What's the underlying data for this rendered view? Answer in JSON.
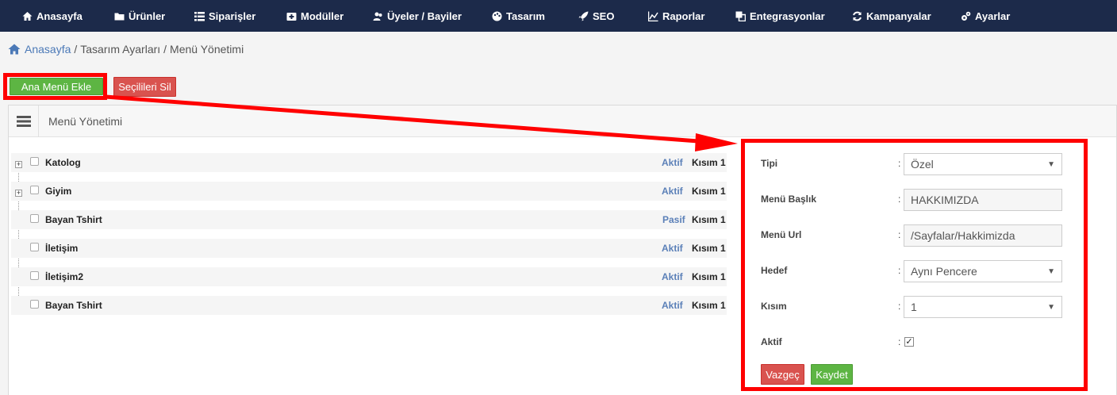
{
  "nav": [
    {
      "label": "Anasayfa",
      "icon": "home-icon"
    },
    {
      "label": "Ürünler",
      "icon": "folder-icon"
    },
    {
      "label": "Siparişler",
      "icon": "list-icon"
    },
    {
      "label": "Modüller",
      "icon": "module-icon"
    },
    {
      "label": "Üyeler / Bayiler",
      "icon": "users-icon"
    },
    {
      "label": "Tasarım",
      "icon": "palette-icon"
    },
    {
      "label": "SEO",
      "icon": "rocket-icon"
    },
    {
      "label": "Raporlar",
      "icon": "chart-icon"
    },
    {
      "label": "Entegrasyonlar",
      "icon": "integration-icon"
    },
    {
      "label": "Kampanyalar",
      "icon": "refresh-icon"
    },
    {
      "label": "Ayarlar",
      "icon": "gear-icon"
    }
  ],
  "breadcrumb": {
    "home": "Anasayfa",
    "sep": "/",
    "items": [
      "Tasarım Ayarları",
      "Menü Yönetimi"
    ]
  },
  "actions": {
    "add_main": "Ana Menü Ekle",
    "delete_selected": "Seçilileri Sil"
  },
  "panel": {
    "title": "Menü Yönetimi"
  },
  "menu_items": [
    {
      "name": "Katolog",
      "status": "Aktif",
      "part": "Kısım 1"
    },
    {
      "name": "Giyim",
      "status": "Aktif",
      "part": "Kısım 1"
    },
    {
      "name": "Bayan Tshirt",
      "status": "Pasif",
      "part": "Kısım 1"
    },
    {
      "name": "İletişim",
      "status": "Aktif",
      "part": "Kısım 1"
    },
    {
      "name": "İletişim2",
      "status": "Aktif",
      "part": "Kısım 1"
    },
    {
      "name": "Bayan Tshirt",
      "status": "Aktif",
      "part": "Kısım 1"
    }
  ],
  "form": {
    "colon": ":",
    "type_label": "Tipi",
    "type_value": "Özel",
    "title_label": "Menü Başlık",
    "title_value": "HAKKIMIZDA",
    "url_label": "Menü Url",
    "url_value": "/Sayfalar/Hakkimizda",
    "target_label": "Hedef",
    "target_value": "Aynı Pencere",
    "part_label": "Kısım",
    "part_value": "1",
    "active_label": "Aktif",
    "active_checked": true,
    "cancel": "Vazgeç",
    "save": "Kaydet"
  },
  "colors": {
    "nav_bg": "#1c2a4a",
    "link": "#4b79b7",
    "green": "#5db543",
    "red": "#d9534f",
    "annotation": "#ff0000"
  }
}
